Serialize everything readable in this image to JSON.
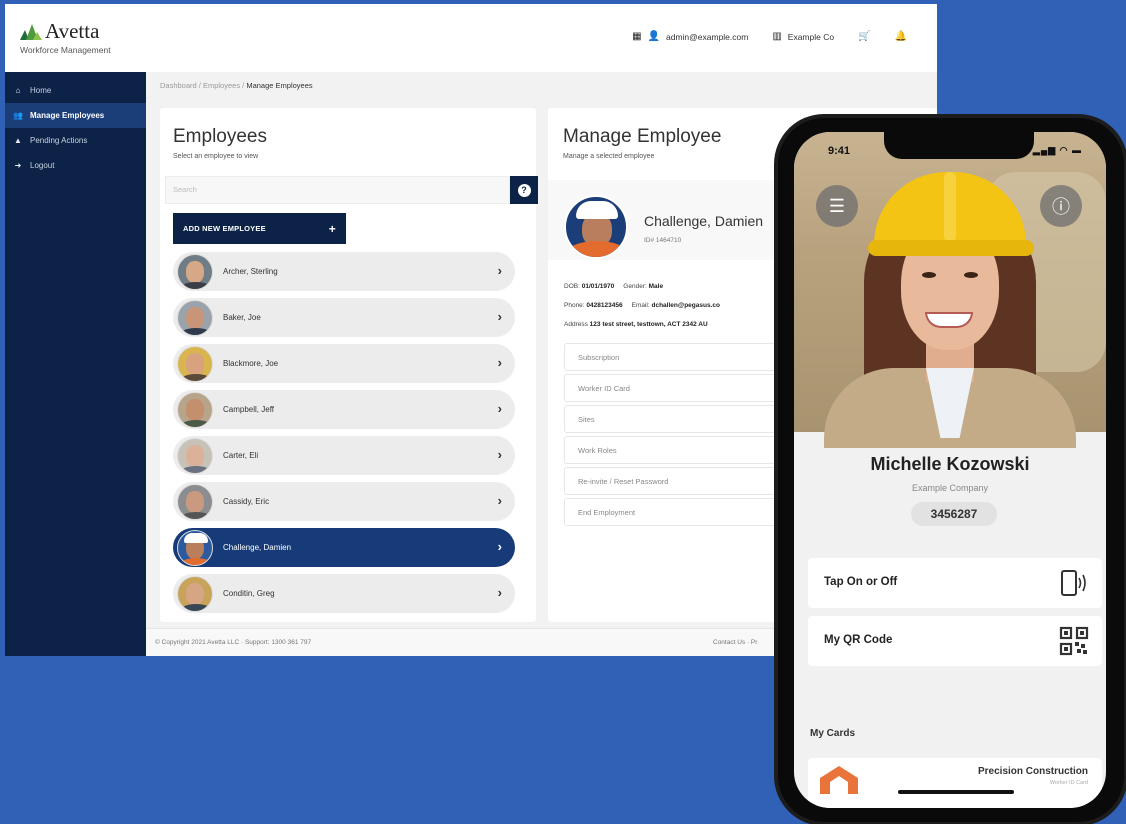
{
  "brand": {
    "name": "Avetta",
    "subtitle": "Workforce Management"
  },
  "topnav": {
    "user": "admin@example.com",
    "company": "Example Co"
  },
  "sidebar": {
    "items": [
      {
        "label": "Home",
        "icon": "home-icon",
        "active": false
      },
      {
        "label": "Manage Employees",
        "icon": "users-icon",
        "active": true
      },
      {
        "label": "Pending Actions",
        "icon": "alert-icon",
        "active": false
      },
      {
        "label": "Logout",
        "icon": "logout-icon",
        "active": false
      }
    ]
  },
  "breadcrumb": {
    "dashboard": "Dashboard",
    "employees": "Employees",
    "current": "Manage Employees"
  },
  "employees_panel": {
    "title": "Employees",
    "subtitle": "Select an employee to view",
    "search_placeholder": "Search",
    "add_button": "ADD NEW EMPLOYEE",
    "list": [
      {
        "name": "Archer, Sterling",
        "active": false
      },
      {
        "name": "Baker, Joe",
        "active": false
      },
      {
        "name": "Blackmore, Joe",
        "active": false
      },
      {
        "name": "Campbell, Jeff",
        "active": false
      },
      {
        "name": "Carter, Eli",
        "active": false
      },
      {
        "name": "Cassidy, Eric",
        "active": false
      },
      {
        "name": "Challenge, Damien",
        "active": true
      },
      {
        "name": "Conditin, Greg",
        "active": false
      }
    ]
  },
  "manage_panel": {
    "title": "Manage Employee",
    "subtitle": "Manage a selected employee",
    "employee_name": "Challenge, Damien",
    "employee_id": "ID# 1464710",
    "dob_label": "DOB:",
    "dob": "01/01/1970",
    "gender_label": "Gender:",
    "gender": "Male",
    "phone_label": "Phone:",
    "phone": "0428123456",
    "email_label": "Email:",
    "email": "dchallen@pegasus.co",
    "address_label": "Address",
    "address": "123 test street, testtown, ACT 2342 AU",
    "menu": [
      "Subscription",
      "Worker ID Card",
      "Sites",
      "Work Roles",
      "Re-invite / Reset Password",
      "End Employment"
    ]
  },
  "footer": {
    "copyright": "© Copyright 2021 Avetta LLC · Support: 1300 361 797",
    "contact": "Contact Us · Pr"
  },
  "phone": {
    "time": "9:41",
    "name": "Michelle Kozowski",
    "company": "Example Company",
    "id": "3456287",
    "tap_label": "Tap On or Off",
    "qr_label": "My QR Code",
    "section": "My Cards",
    "card_org": "Precision Construction",
    "card_sub": "Worker ID Card"
  },
  "colors": {
    "background": "#3161b6",
    "navy": "#0c2347",
    "active_row": "#173b78",
    "accent_orange": "#e8743b",
    "helmet_yellow": "#f4c414"
  }
}
